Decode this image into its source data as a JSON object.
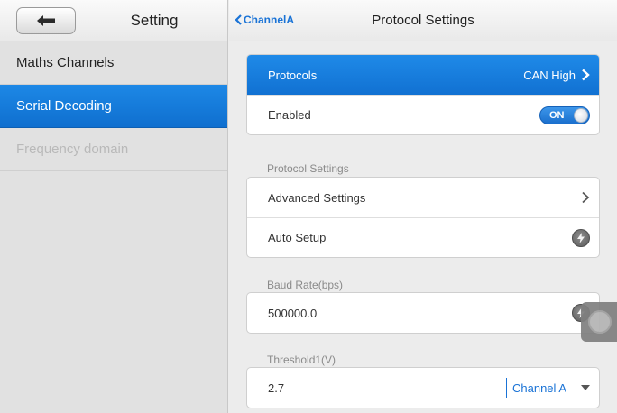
{
  "left_panel": {
    "title": "Setting",
    "items": [
      {
        "label": "Maths Channels",
        "state": "normal"
      },
      {
        "label": "Serial Decoding",
        "state": "active"
      },
      {
        "label": "Frequency domain",
        "state": "disabled"
      }
    ]
  },
  "right_panel": {
    "breadcrumb": "ChannelA",
    "title": "Protocol Settings",
    "protocols": {
      "label": "Protocols",
      "value": "CAN High"
    },
    "enabled": {
      "label": "Enabled",
      "toggle": "ON"
    },
    "protocol_settings": {
      "section_label": "Protocol Settings",
      "advanced": "Advanced Settings",
      "auto_setup": "Auto Setup"
    },
    "baud_rate": {
      "section_label": "Baud Rate(bps)",
      "value": "500000.0"
    },
    "threshold1": {
      "section_label": "Threshold1(V)",
      "value": "2.7",
      "channel": "Channel A"
    }
  },
  "colors": {
    "accent": "#1171d2",
    "link": "#1a73d6",
    "disabled_text": "#b9b9b9"
  }
}
